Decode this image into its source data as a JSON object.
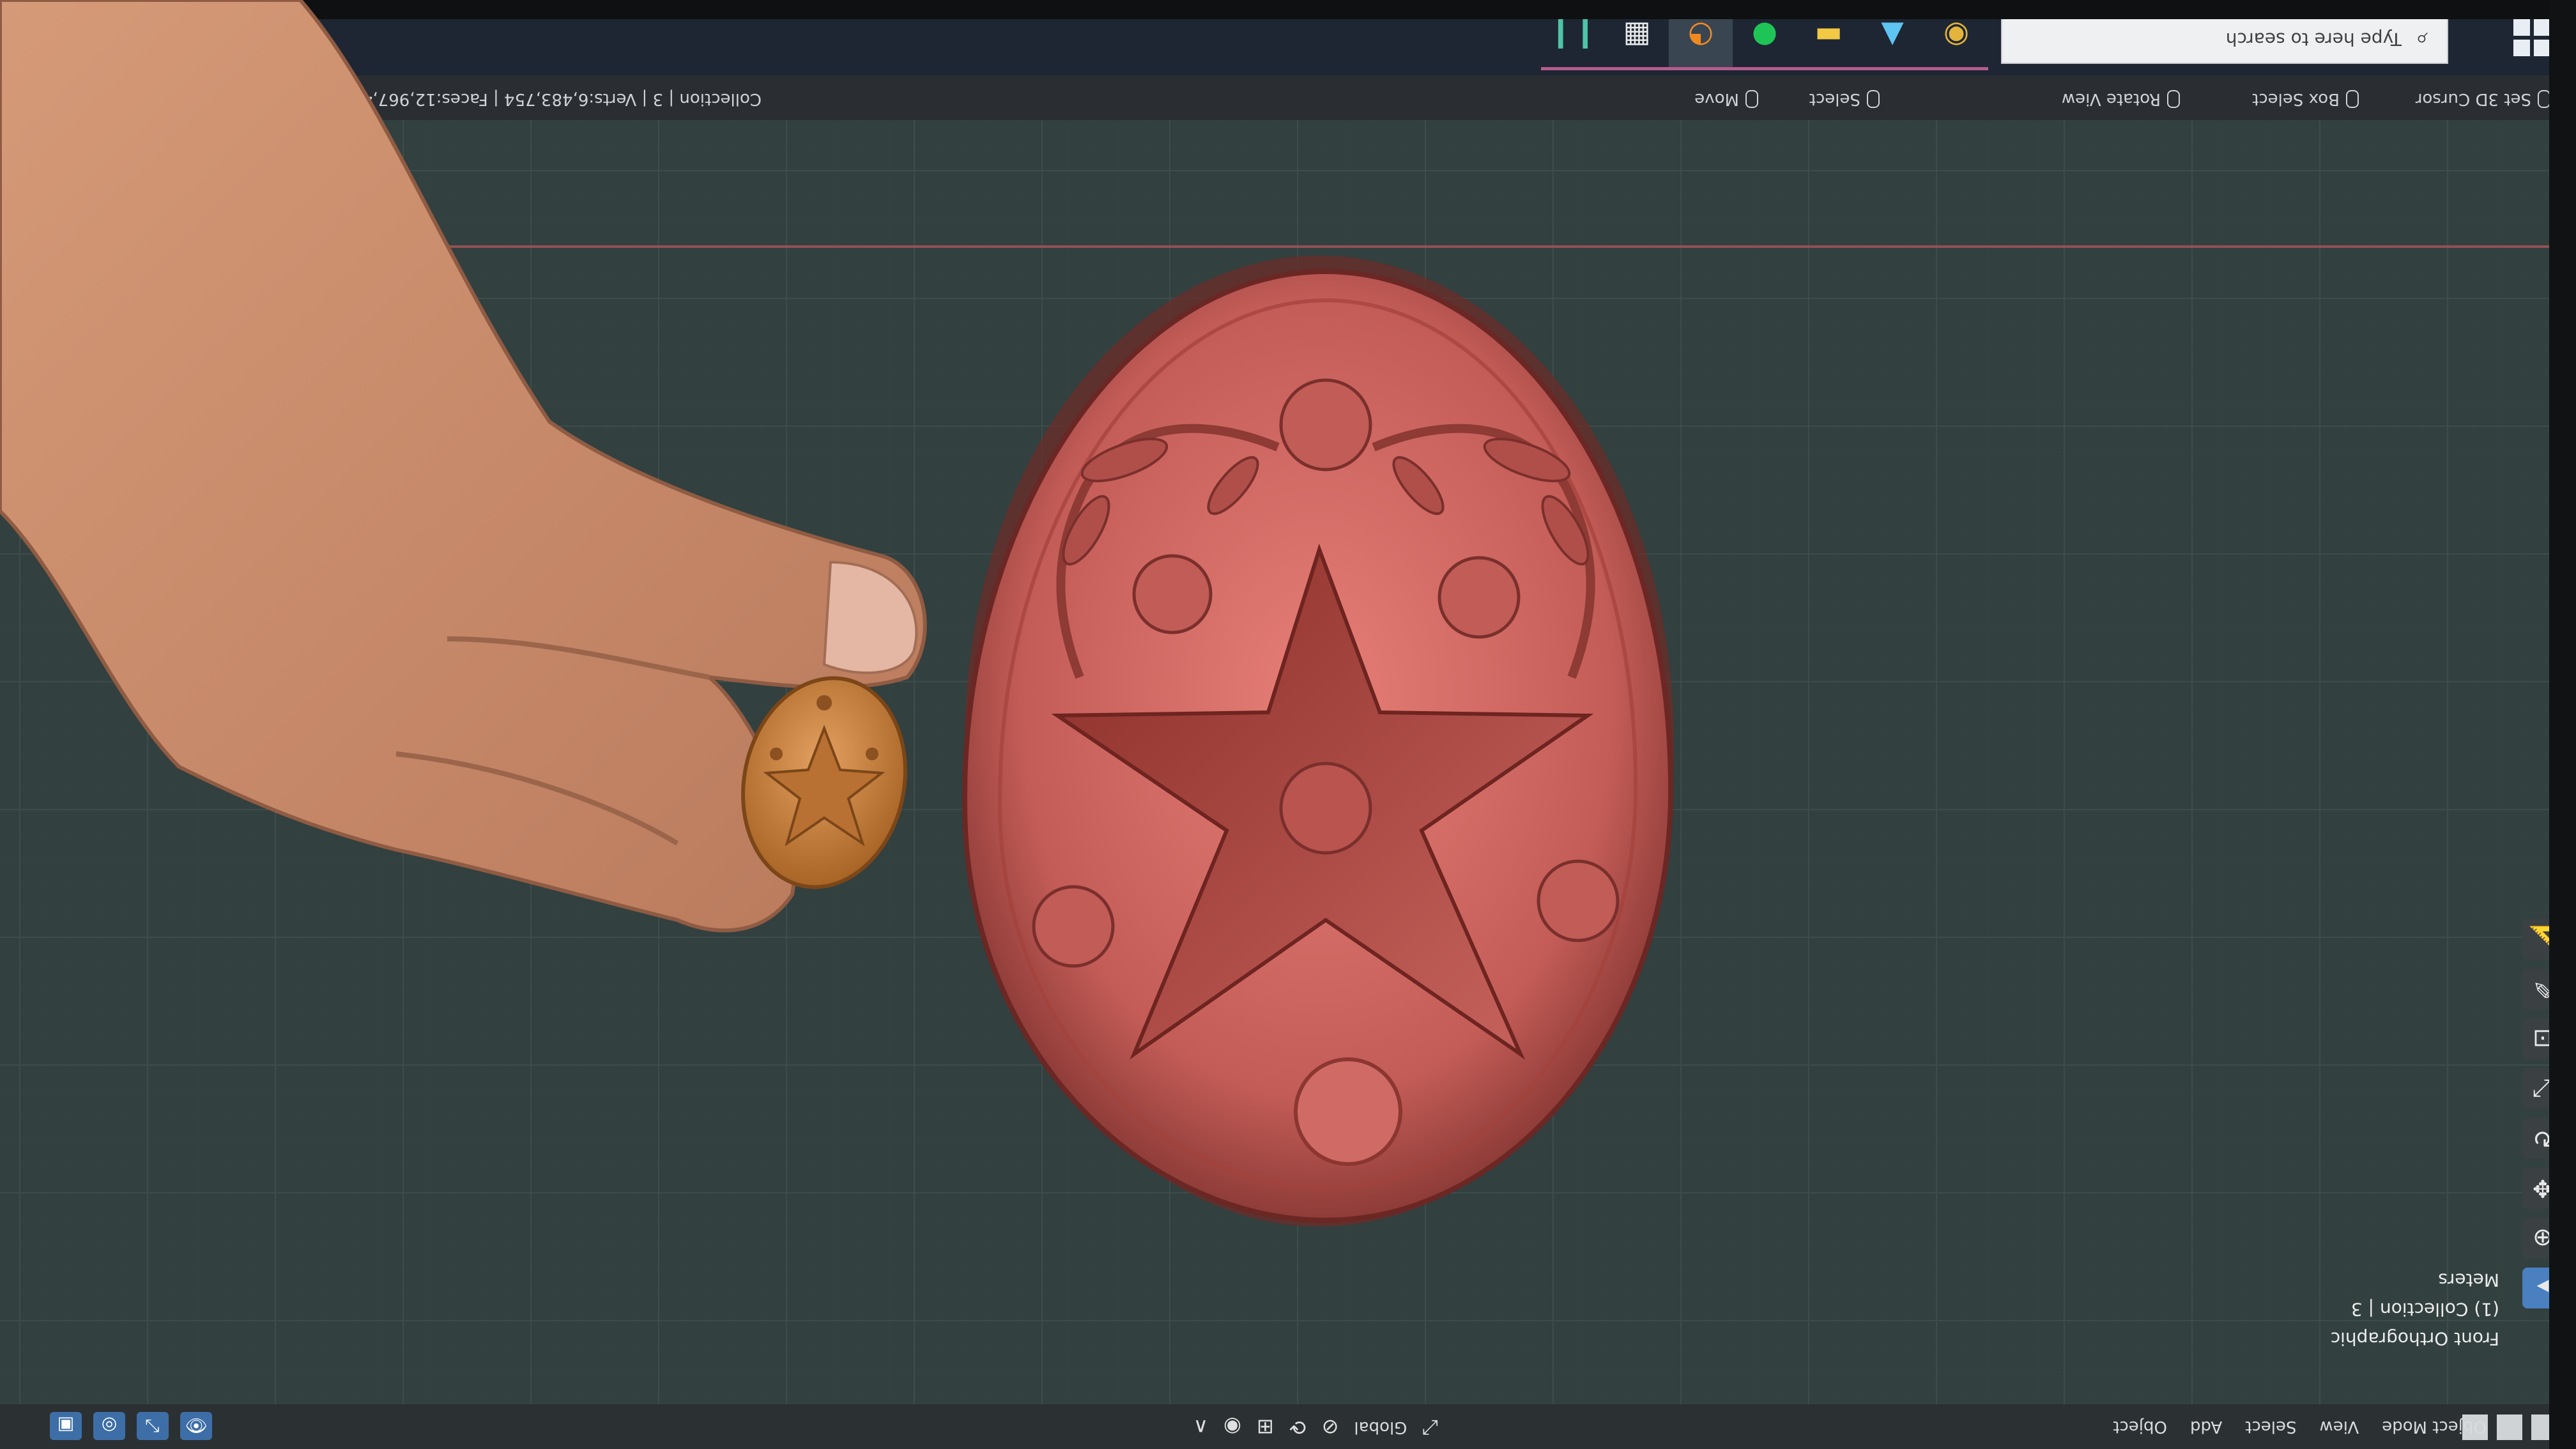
{
  "taskbar": {
    "search_placeholder": "Type here to search",
    "apps": [
      "audio-app-icon",
      "calculator-icon",
      "blender-icon",
      "line-chat-icon",
      "file-explorer-icon",
      "photos-icon",
      "chrome-icon"
    ]
  },
  "status_bar": {
    "hints": [
      "Set 3D Cursor",
      "Box Select",
      "Rotate View",
      "Select",
      "Move"
    ],
    "stats": "Collection | 3 | Verts:6,483,754 | Faces:12,967,492 | Tris:"
  },
  "header": {
    "mode": "Object Mode",
    "menu": [
      "View",
      "Select",
      "Add",
      "Object"
    ],
    "transform_orientation": "Global"
  },
  "viewport_overlay": {
    "view_name": "Front Orthographic",
    "collection": "(1) Collection | 3",
    "units": "Meters"
  },
  "colors": {
    "model": "#c9655f",
    "accent": "#4a7fc0",
    "grid": "#32403f"
  }
}
